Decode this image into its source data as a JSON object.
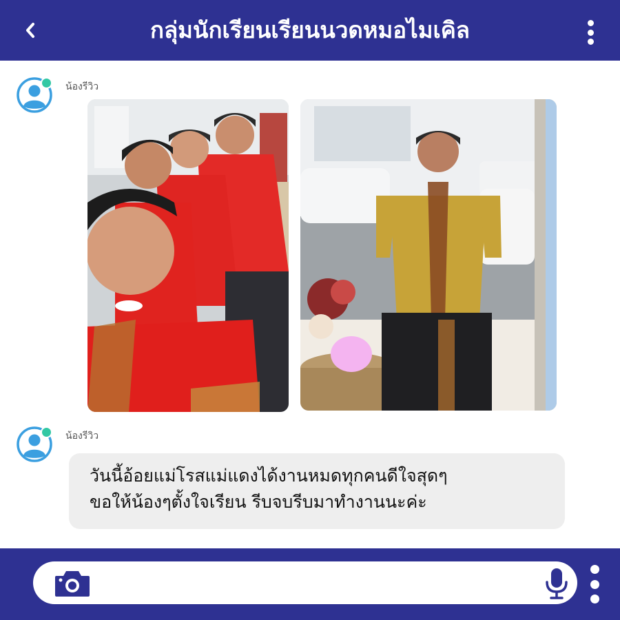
{
  "header": {
    "title": "กลุ่มนักเรียนเรียนนวดหมอไมเคิล",
    "back_icon": "chevron-left-icon",
    "menu_icon": "kebab-menu-icon"
  },
  "colors": {
    "primary": "#2e3192",
    "online": "#32c8a4",
    "avatar": "#3b9fe0",
    "bubble": "#eeeeee"
  },
  "messages": [
    {
      "sender": "น้องรีวิว",
      "type": "photos",
      "photos": [
        {
          "alt": "group-selfie-red-uniforms"
        },
        {
          "alt": "woman-yellow-uniform-by-window"
        }
      ]
    },
    {
      "sender": "น้องรีวิว",
      "type": "text",
      "lines": [
        "วันนี้อ้อยแม่โรสแม่แดงได้งานหมดทุกคนดีใจสุดๆ",
        "ขอให้น้องๆตั้งใจเรียน รีบจบรีบมาทำงานนะค่ะ"
      ]
    }
  ],
  "composer": {
    "placeholder": "",
    "camera_icon": "camera-icon",
    "mic_icon": "microphone-icon",
    "menu_icon": "kebab-menu-icon"
  }
}
